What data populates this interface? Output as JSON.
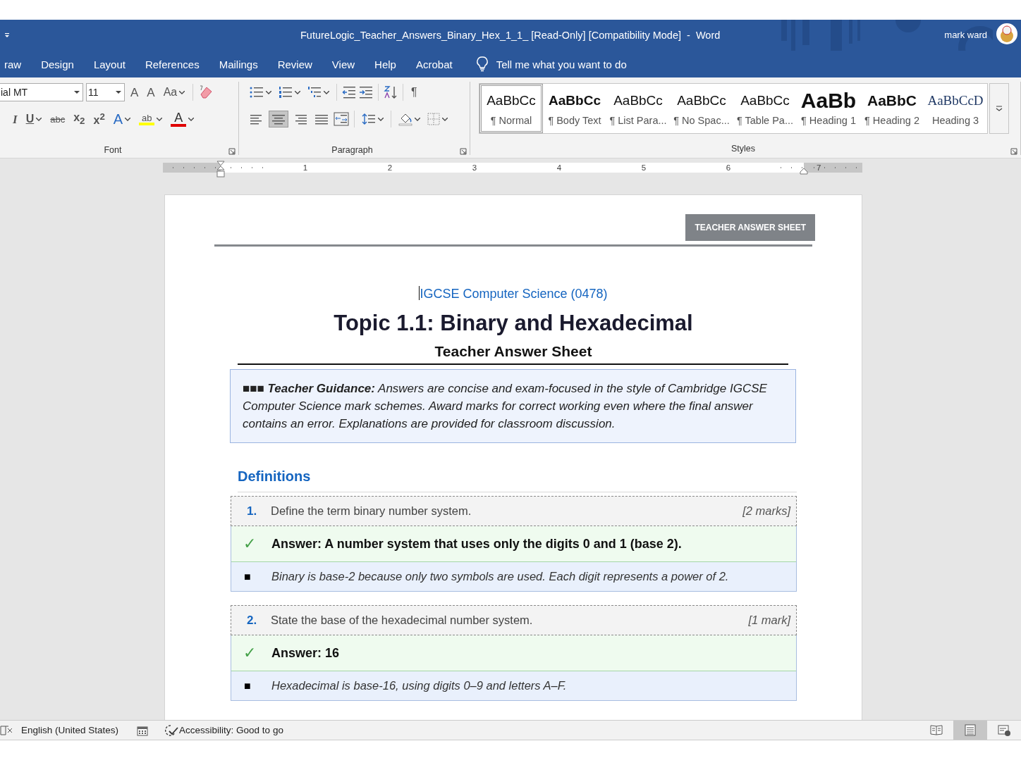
{
  "window": {
    "title": "FutureLogic_Teacher_Answers_Binary_Hex_1_1_ [Read-Only] [Compatibility Mode]  -  Word",
    "user": "mark ward"
  },
  "tabs": [
    {
      "label": "raw",
      "selected": false
    },
    {
      "label": "Design",
      "selected": false
    },
    {
      "label": "Layout",
      "selected": false
    },
    {
      "label": "References",
      "selected": false
    },
    {
      "label": "Mailings",
      "selected": false
    },
    {
      "label": "Review",
      "selected": false
    },
    {
      "label": "View",
      "selected": false
    },
    {
      "label": "Help",
      "selected": false
    },
    {
      "label": "Acrobat",
      "selected": false
    }
  ],
  "tell_me": {
    "placeholder": "Tell me what you want to do"
  },
  "font_group": {
    "label": "Font",
    "font_name": "ial MT",
    "font_size": "11",
    "top_buttons": [
      {
        "kind": "grow",
        "text": "A"
      },
      {
        "kind": "shrink",
        "text": "A"
      },
      {
        "kind": "case",
        "text": "Aa"
      }
    ],
    "bottom_buttons": [
      {
        "kind": "italic",
        "text": "I"
      },
      {
        "kind": "underline",
        "text": "U"
      },
      {
        "kind": "strike",
        "text": "abc"
      },
      {
        "kind": "subscript",
        "text": "x$_{2}$"
      },
      {
        "kind": "superscript",
        "text": "x$^{2}$"
      },
      {
        "kind": "effects",
        "text": "A"
      },
      {
        "kind": "highlight",
        "text": "ab"
      },
      {
        "kind": "color",
        "text": "A"
      }
    ]
  },
  "paragraph_group": {
    "label": "Paragraph",
    "marks_button": "¶",
    "alignment": [
      {
        "kind": "left",
        "selected": false
      },
      {
        "kind": "center",
        "selected": true
      },
      {
        "kind": "right",
        "selected": false
      },
      {
        "kind": "justify",
        "selected": false
      }
    ]
  },
  "styles_group": {
    "label": "Styles",
    "styles": [
      {
        "kind": "normal",
        "preview": "AaBbCc",
        "label": "¶ Normal",
        "selected": true
      },
      {
        "kind": "bold",
        "preview": "AaBbCc",
        "label": "¶ Body Text",
        "selected": false
      },
      {
        "kind": "normal",
        "preview": "AaBbCc",
        "label": "¶ List Para...",
        "selected": false
      },
      {
        "kind": "normal",
        "preview": "AaBbCc",
        "label": "¶ No Spac...",
        "selected": false
      },
      {
        "kind": "normal",
        "preview": "AaBbCc",
        "label": "¶ Table Pa...",
        "selected": false
      },
      {
        "kind": "heading1",
        "preview": "AaBb",
        "label": "¶ Heading 1",
        "selected": false
      },
      {
        "kind": "heading2",
        "preview": "AaBbC",
        "label": "¶ Heading 2",
        "selected": false
      },
      {
        "kind": "heading3",
        "preview": "AaBbCcD",
        "label": "Heading 3",
        "selected": false
      }
    ]
  },
  "ruler": {
    "numbers": [
      "1",
      "2",
      "3",
      "4",
      "5",
      "6",
      "7"
    ]
  },
  "document": {
    "header_badge": "TEACHER ANSWER SHEET",
    "course": "IGCSE Computer Science (0478)",
    "title": "Topic 1.1: Binary and Hexadecimal",
    "subtitle": "Teacher Answer Sheet",
    "guidance": "■■■ **Teacher Guidance:** Answers are concise and exam-focused in the style of Cambridge IGCSE Computer Science mark schemes. Award marks for correct working even where the final answer contains an error. Explanations are provided for classroom discussion.",
    "section": "Definitions",
    "questions": [
      {
        "number": "1.",
        "question": "Define the term binary number system.",
        "marks": "[2 marks]",
        "answer_mark": "✓",
        "answer": "Answer: A number system that uses only the digits 0 and 1 (base 2).",
        "note_mark": "■",
        "note": "Binary is base-2 because only two symbols are used. Each digit represents a power of 2."
      },
      {
        "number": "2.",
        "question": "State the base of the hexadecimal number system.",
        "marks": "[1 mark]",
        "answer_mark": "✓",
        "answer": "Answer: 16",
        "note_mark": "■",
        "note": "Hexadecimal is base-16, using digits 0–9 and letters A–F."
      }
    ]
  },
  "status_bar": {
    "language": "English (United States)",
    "accessibility": "Accessibility: Good to go",
    "views": [
      {
        "kind": "read",
        "selected": false
      },
      {
        "kind": "print",
        "selected": true
      },
      {
        "kind": "web",
        "selected": false
      }
    ]
  }
}
